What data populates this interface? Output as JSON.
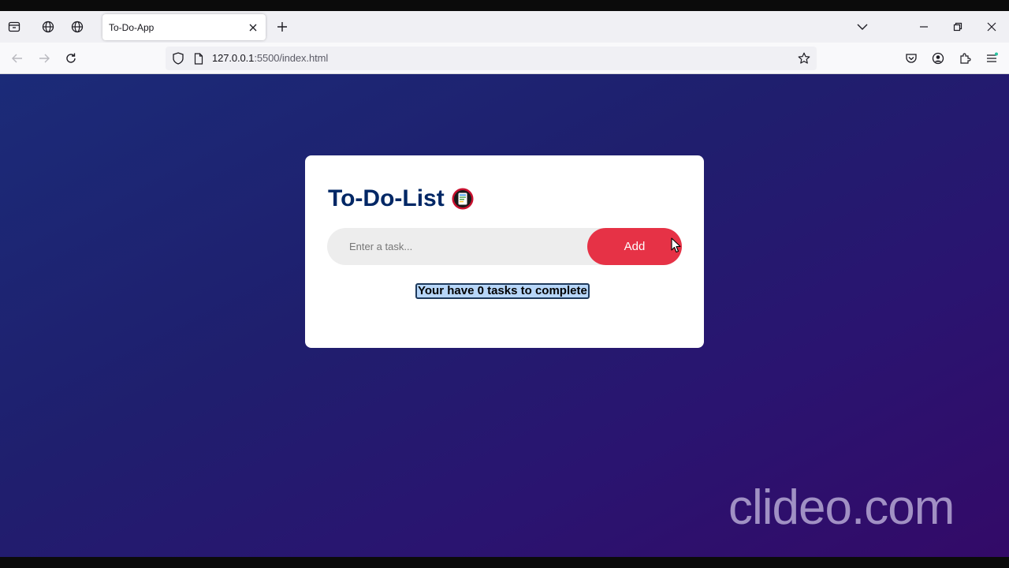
{
  "browser": {
    "tab": {
      "title": "To-Do-App"
    },
    "url": {
      "host": "127.0.0.1",
      "path": ":5500/index.html"
    }
  },
  "app": {
    "title": "To-Do-List",
    "input": {
      "placeholder": "Enter a task..."
    },
    "add_label": "Add",
    "status_text": "Your have 0 tasks to complete"
  },
  "colors": {
    "accent": "#e63246",
    "title": "#002765"
  },
  "watermark": "clideo.com"
}
